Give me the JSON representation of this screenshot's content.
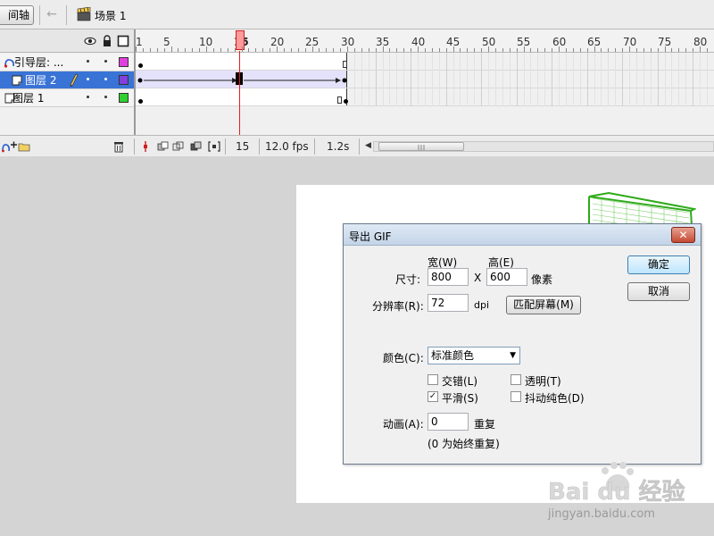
{
  "toolbar": {
    "timeline_button": "间轴",
    "scene_label": "场景 1"
  },
  "timeline": {
    "layers": [
      {
        "name": "引导层: ...",
        "color": "#e040e0",
        "selected": false
      },
      {
        "name": "图层 2",
        "color": "#8040e0",
        "selected": true
      },
      {
        "name": "图层 1",
        "color": "#30d030",
        "selected": false
      }
    ],
    "ruler_numbers": [
      "1",
      "5",
      "10",
      "15",
      "20",
      "25",
      "30",
      "35",
      "40",
      "45",
      "50",
      "55",
      "60",
      "65",
      "70",
      "75",
      "80"
    ],
    "current_frame": "15",
    "frame_rate": "12.0 fps",
    "elapsed_time": "1.2s",
    "playhead_color": "#e02020"
  },
  "dialog": {
    "title": "导出 GIF",
    "width_header": "宽(W)",
    "height_header": "高(E)",
    "size_label": "尺寸:",
    "width_value": "800",
    "x_separator": "X",
    "height_value": "600",
    "pixels_unit": "像素",
    "resolution_label": "分辨率(R):",
    "resolution_value": "72",
    "dpi_unit": "dpi",
    "match_screen_button": "匹配屏幕(M)",
    "ok_button": "确定",
    "cancel_button": "取消",
    "color_label": "颜色(C):",
    "color_selected": "标准颜色",
    "interlace_label": "交错(L)",
    "transparent_label": "透明(T)",
    "smooth_label": "平滑(S)",
    "dither_label": "抖动纯色(D)",
    "smooth_checked": true,
    "animation_label": "动画(A):",
    "animation_value": "0",
    "repeat_label": "重复",
    "repeat_hint": "(0 为始终重复)"
  },
  "watermark": {
    "brand_text": "Bai du 经验",
    "url_text": "jingyan.baidu.com"
  }
}
